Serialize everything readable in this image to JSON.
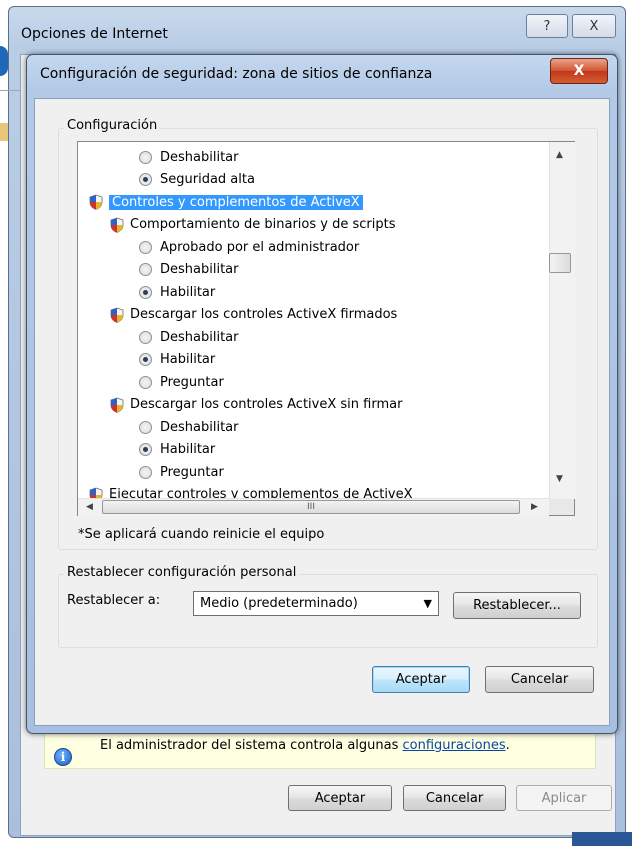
{
  "outer_window": {
    "title": "Opciones de Internet",
    "help_label": "?",
    "close_label": "X",
    "info_text": "El administrador del sistema controla algunas",
    "info_link": "configuraciones",
    "info_period": ".",
    "buttons": {
      "ok": "Aceptar",
      "cancel": "Cancelar",
      "apply": "Aplicar"
    }
  },
  "dialog": {
    "title": "Configuración de seguridad: zona de sitios de confianza",
    "close_label": "X",
    "settings_group_label": "Configuración",
    "tree": [
      {
        "type": "radio",
        "label": "Deshabilitar",
        "checked": false,
        "indent": 1
      },
      {
        "type": "radio",
        "label": "Seguridad alta",
        "checked": true,
        "indent": 1
      },
      {
        "type": "category",
        "label": "Controles y complementos de ActiveX",
        "selected": true,
        "indent": 0
      },
      {
        "type": "category",
        "label": "Comportamiento de binarios y de scripts",
        "indent": 1
      },
      {
        "type": "radio",
        "label": "Aprobado por el administrador",
        "checked": false,
        "indent": 1
      },
      {
        "type": "radio",
        "label": "Deshabilitar",
        "checked": false,
        "indent": 1
      },
      {
        "type": "radio",
        "label": "Habilitar",
        "checked": true,
        "indent": 1
      },
      {
        "type": "category",
        "label": "Descargar los controles ActiveX firmados",
        "indent": 1
      },
      {
        "type": "radio",
        "label": "Deshabilitar",
        "checked": false,
        "indent": 1
      },
      {
        "type": "radio",
        "label": "Habilitar",
        "checked": true,
        "indent": 1
      },
      {
        "type": "radio",
        "label": "Preguntar",
        "checked": false,
        "indent": 1
      },
      {
        "type": "category",
        "label": "Descargar los controles ActiveX sin firmar",
        "indent": 1
      },
      {
        "type": "radio",
        "label": "Deshabilitar",
        "checked": false,
        "indent": 1
      },
      {
        "type": "radio",
        "label": "Habilitar",
        "checked": true,
        "indent": 1
      },
      {
        "type": "radio",
        "label": "Preguntar",
        "checked": false,
        "indent": 1
      },
      {
        "type": "category",
        "label": "Ejecutar controles y complementos de ActiveX",
        "indent": 0
      }
    ],
    "hscroll_grip": "III",
    "note": "*Se aplicará cuando reinicie el equipo",
    "reset_group_label": "Restablecer configuración personal",
    "reset_to_label": "Restablecer a:",
    "reset_combo_value": "Medio (predeterminado)",
    "reset_button": "Restablecer...",
    "ok_button": "Aceptar",
    "cancel_button": "Cancelar"
  },
  "colors": {
    "selection": "#3399ff",
    "link": "#0645ad",
    "info_bar": "#ffffe1",
    "close_red": "#c0381a"
  }
}
